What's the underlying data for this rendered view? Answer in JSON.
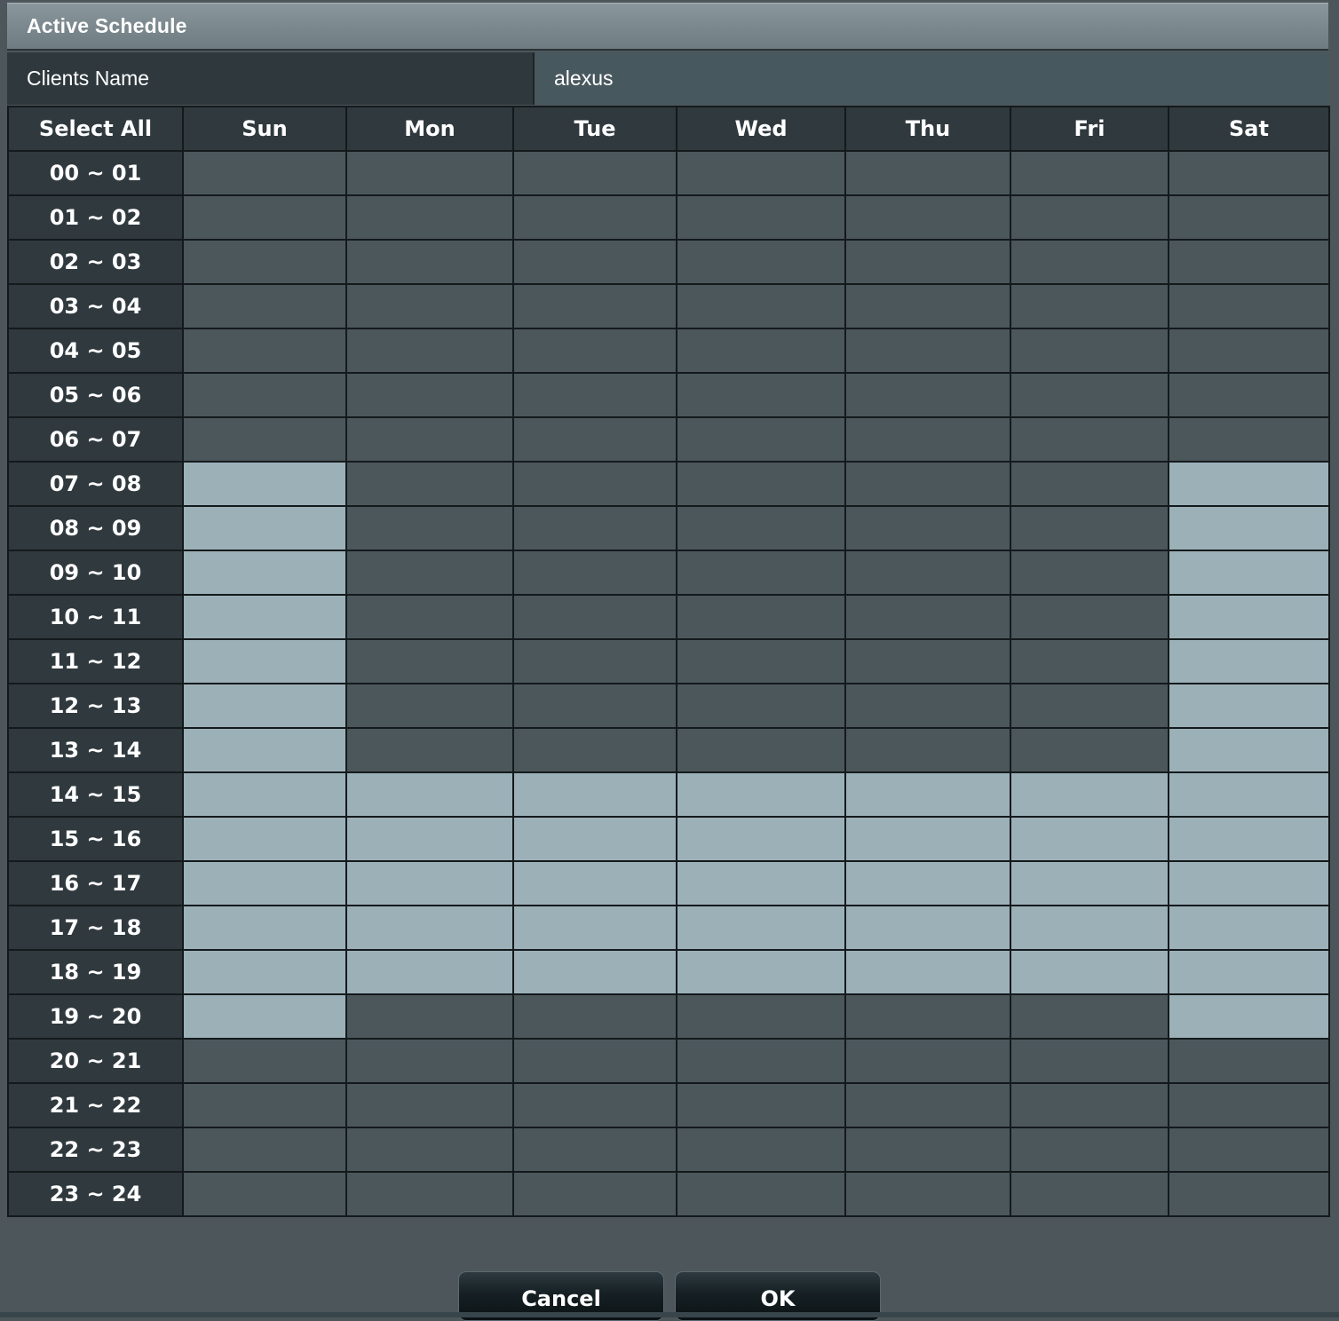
{
  "dialog": {
    "title": "Active Schedule"
  },
  "client": {
    "label": "Clients Name",
    "value": "alexus"
  },
  "schedule": {
    "select_all_label": "Select All",
    "days": [
      "Sun",
      "Mon",
      "Tue",
      "Wed",
      "Thu",
      "Fri",
      "Sat"
    ],
    "rows": [
      {
        "label": "00 ~ 01",
        "active": [
          false,
          false,
          false,
          false,
          false,
          false,
          false
        ]
      },
      {
        "label": "01 ~ 02",
        "active": [
          false,
          false,
          false,
          false,
          false,
          false,
          false
        ]
      },
      {
        "label": "02 ~ 03",
        "active": [
          false,
          false,
          false,
          false,
          false,
          false,
          false
        ]
      },
      {
        "label": "03 ~ 04",
        "active": [
          false,
          false,
          false,
          false,
          false,
          false,
          false
        ]
      },
      {
        "label": "04 ~ 05",
        "active": [
          false,
          false,
          false,
          false,
          false,
          false,
          false
        ]
      },
      {
        "label": "05 ~ 06",
        "active": [
          false,
          false,
          false,
          false,
          false,
          false,
          false
        ]
      },
      {
        "label": "06 ~ 07",
        "active": [
          false,
          false,
          false,
          false,
          false,
          false,
          false
        ]
      },
      {
        "label": "07 ~ 08",
        "active": [
          true,
          false,
          false,
          false,
          false,
          false,
          true
        ]
      },
      {
        "label": "08 ~ 09",
        "active": [
          true,
          false,
          false,
          false,
          false,
          false,
          true
        ]
      },
      {
        "label": "09 ~ 10",
        "active": [
          true,
          false,
          false,
          false,
          false,
          false,
          true
        ]
      },
      {
        "label": "10 ~ 11",
        "active": [
          true,
          false,
          false,
          false,
          false,
          false,
          true
        ]
      },
      {
        "label": "11 ~ 12",
        "active": [
          true,
          false,
          false,
          false,
          false,
          false,
          true
        ]
      },
      {
        "label": "12 ~ 13",
        "active": [
          true,
          false,
          false,
          false,
          false,
          false,
          true
        ]
      },
      {
        "label": "13 ~ 14",
        "active": [
          true,
          false,
          false,
          false,
          false,
          false,
          true
        ]
      },
      {
        "label": "14 ~ 15",
        "active": [
          true,
          true,
          true,
          true,
          true,
          true,
          true
        ]
      },
      {
        "label": "15 ~ 16",
        "active": [
          true,
          true,
          true,
          true,
          true,
          true,
          true
        ]
      },
      {
        "label": "16 ~ 17",
        "active": [
          true,
          true,
          true,
          true,
          true,
          true,
          true
        ]
      },
      {
        "label": "17 ~ 18",
        "active": [
          true,
          true,
          true,
          true,
          true,
          true,
          true
        ]
      },
      {
        "label": "18 ~ 19",
        "active": [
          true,
          true,
          true,
          true,
          true,
          true,
          true
        ]
      },
      {
        "label": "19 ~ 20",
        "active": [
          true,
          false,
          false,
          false,
          false,
          false,
          true
        ]
      },
      {
        "label": "20 ~ 21",
        "active": [
          false,
          false,
          false,
          false,
          false,
          false,
          false
        ]
      },
      {
        "label": "21 ~ 22",
        "active": [
          false,
          false,
          false,
          false,
          false,
          false,
          false
        ]
      },
      {
        "label": "22 ~ 23",
        "active": [
          false,
          false,
          false,
          false,
          false,
          false,
          false
        ]
      },
      {
        "label": "23 ~ 24",
        "active": [
          false,
          false,
          false,
          false,
          false,
          false,
          false
        ]
      }
    ]
  },
  "buttons": {
    "cancel_label": "Cancel",
    "ok_label": "OK"
  },
  "colors": {
    "active_slot": "#9cb0b8",
    "inactive_slot": "#4c575c",
    "header_bg": "#2f393e"
  }
}
